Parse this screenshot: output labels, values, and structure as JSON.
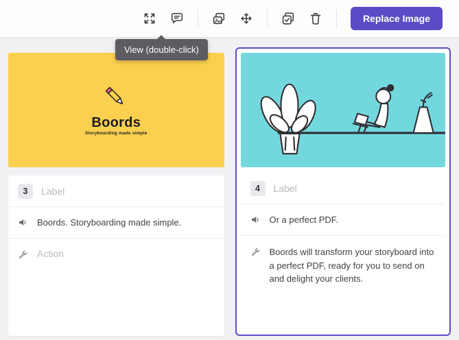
{
  "colors": {
    "accent": "#5b4bc7",
    "frame_yellow": "#fbd04f",
    "frame_cyan": "#73d8de",
    "tooltip_bg": "#5d5c62"
  },
  "toolbar": {
    "replace_image_label": "Replace Image",
    "icon_names": [
      "view-expand",
      "comment",
      "swap-image",
      "move",
      "duplicate",
      "delete"
    ]
  },
  "tooltip": {
    "text": "View (double-click)"
  },
  "frames": [
    {
      "number": "3",
      "label_placeholder": "Label",
      "dialogue": "Boords. Storyboarding made simple.",
      "action_placeholder": "Action",
      "image": {
        "background": "#fbd04f",
        "description": "boords-logo-pencil",
        "logo_title": "Boords",
        "logo_subtitle": "Storyboarding made simple"
      }
    },
    {
      "number": "4",
      "label_placeholder": "Label",
      "dialogue": "Or a perfect PDF.",
      "action": "Boords will transform your storyboard into a perfect PDF, ready for you to send on and delight your clients.",
      "selected": true,
      "image": {
        "background": "#73d8de",
        "description": "illustration-person-laptop-plants"
      }
    }
  ]
}
